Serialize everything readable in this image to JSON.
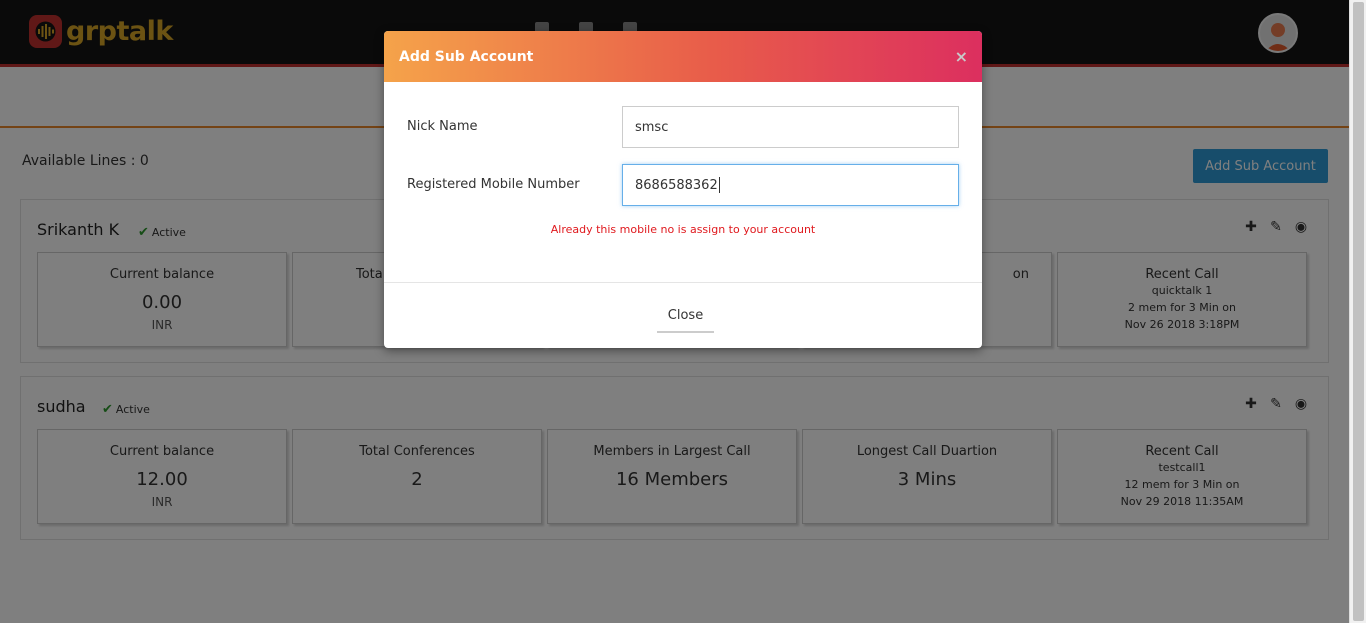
{
  "app": {
    "logo_text": "grptalk"
  },
  "nav": {
    "items": [
      "",
      "",
      ""
    ]
  },
  "main": {
    "available_lines": "Available Lines : 0",
    "add_button": "Add Sub Account"
  },
  "accounts": [
    {
      "name": "Srikanth K",
      "status": "Active",
      "stats": [
        {
          "title": "Current balance",
          "value": "0.00",
          "unit": "INR"
        },
        {
          "title": "Total",
          "value": "",
          "unit": ""
        },
        {
          "title": "",
          "value": "",
          "unit": ""
        },
        {
          "title": "on",
          "value": "",
          "unit": ""
        },
        {
          "title": "Recent Call",
          "lines": [
            "quicktalk 1",
            "2 mem for 3 Min on",
            "Nov 26 2018 3:18PM"
          ]
        }
      ]
    },
    {
      "name": "sudha",
      "status": "Active",
      "stats": [
        {
          "title": "Current balance",
          "value": "12.00",
          "unit": "INR"
        },
        {
          "title": "Total Conferences",
          "value": "2",
          "unit": ""
        },
        {
          "title": "Members in Largest Call",
          "value": "16 Members",
          "unit": ""
        },
        {
          "title": "Longest Call Duartion",
          "value": "3 Mins",
          "unit": ""
        },
        {
          "title": "Recent Call",
          "lines": [
            "testcall1",
            "12 mem for 3 Min on",
            "Nov 29 2018 11:35AM"
          ]
        }
      ]
    }
  ],
  "modal": {
    "title": "Add Sub Account",
    "close_icon": "×",
    "nick_label": "Nick Name",
    "nick_value": "smsc",
    "mobile_label": "Registered Mobile Number",
    "mobile_value": "8686588362",
    "error": "Already this mobile no is assign to your account",
    "close_button": "Close"
  },
  "colors": {
    "accent_blue": "#2e9bd6",
    "header_gradient_start": "#f5a34a",
    "header_gradient_end": "#dc2f5f",
    "error_red": "#e0191e",
    "active_green": "#2c9a2c"
  }
}
